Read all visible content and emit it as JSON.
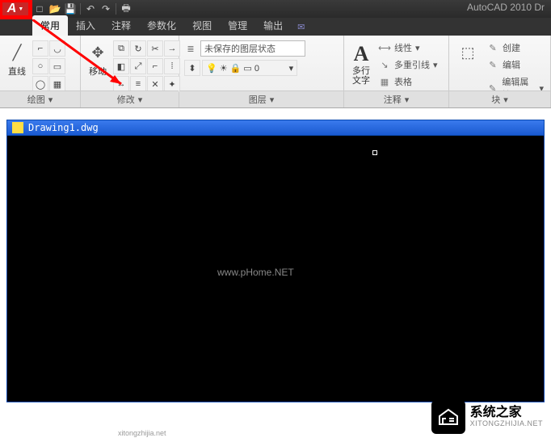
{
  "app": {
    "title": "AutoCAD 2010  Dr"
  },
  "qat": {
    "items": [
      "new",
      "open",
      "save",
      "undo",
      "redo",
      "print"
    ]
  },
  "tabs": [
    {
      "id": "home",
      "label": "常用",
      "active": true
    },
    {
      "id": "insert",
      "label": "插入"
    },
    {
      "id": "annotate",
      "label": "注释"
    },
    {
      "id": "parametric",
      "label": "参数化"
    },
    {
      "id": "view",
      "label": "视图"
    },
    {
      "id": "manage",
      "label": "管理"
    },
    {
      "id": "output",
      "label": "输出"
    }
  ],
  "panels": {
    "draw": {
      "title": "绘图",
      "line_label": "直线"
    },
    "modify": {
      "title": "修改",
      "move_label": "移动"
    },
    "layer": {
      "title": "图层",
      "combo_text": "未保存的图层状态"
    },
    "annotation": {
      "title": "注释",
      "text_label": "多行\n文字",
      "linear": "线性",
      "mleader": "多重引线",
      "table": "表格"
    },
    "block": {
      "title": "块",
      "create": "创建",
      "edit": "编辑",
      "editattr": "编辑属性"
    }
  },
  "drawing": {
    "filename": "Drawing1.dwg"
  },
  "watermarks": {
    "center": "www.pHome.NET",
    "corner": "xitongzhijia.net"
  },
  "site": {
    "cn": "系统之家",
    "en": "XITONGZHIJIA.NET"
  }
}
